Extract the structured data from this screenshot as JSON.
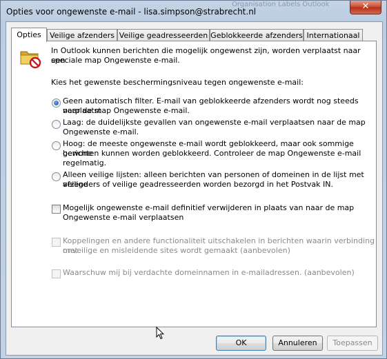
{
  "window": {
    "title": "Opties voor ongewenste e-mail - lisa.simpson@strabrecht.nl",
    "close_glyph": "✕",
    "background_text": "Organisation   Labels   Outlook"
  },
  "tabs": [
    {
      "label": "Opties",
      "active": true
    },
    {
      "label": "Veilige afzenders",
      "active": false
    },
    {
      "label": "Veilige geadresseerden",
      "active": false
    },
    {
      "label": "Geblokkeerde afzenders",
      "active": false
    },
    {
      "label": "Internationaal",
      "active": false
    }
  ],
  "intro": {
    "icon": "junk-mail-folder-icon",
    "line1": "In Outlook kunnen berichten die mogelijk ongewenst zijn, worden verplaatst naar een",
    "line2": "speciale map Ongewenste e-mail."
  },
  "level_prompt": "Kies het gewenste beschermingsniveau tegen ongewenste e-mail:",
  "levels": [
    {
      "selected": true,
      "lines": [
        "Geen automatisch filter. E-mail van geblokkeerde afzenders wordt nog steeds verplaatst",
        "naar de map Ongewenste e-mail."
      ]
    },
    {
      "selected": false,
      "lines": [
        "Laag: de duidelijkste gevallen van ongewenste e-mail verplaatsen naar de map",
        "Ongewenste e-mail."
      ]
    },
    {
      "selected": false,
      "lines": [
        "Hoog: de meeste ongewenste e-mail wordt geblokkeerd, maar ook sommige gewone",
        "berichten kunnen worden geblokkeerd. Controleer de map Ongewenste e-mail",
        "regelmatig."
      ]
    },
    {
      "selected": false,
      "lines": [
        "Alleen veilige lijsten: alleen berichten van personen of domeinen in de lijst met veilige",
        "afzenders of veilige geadresseerden worden bezorgd in het Postvak IN."
      ]
    }
  ],
  "options": [
    {
      "checked": false,
      "disabled": false,
      "lines": [
        "Mogelijk ongewenste e-mail definitief verwijderen in plaats van naar de map",
        "Ongewenste e-mail verplaatsen"
      ]
    },
    {
      "checked": false,
      "disabled": true,
      "lines": [
        "Koppelingen en andere functionaliteit uitschakelen in berichten waarin verbinding met",
        "onveilige en misleidende sites wordt gemaakt (aanbevolen)"
      ]
    },
    {
      "checked": false,
      "disabled": true,
      "lines": [
        "Waarschuw mij bij verdachte domeinnamen in e-mailadressen. (aanbevolen)"
      ]
    }
  ],
  "buttons": {
    "ok": "OK",
    "cancel": "Annuleren",
    "apply": "Toepassen"
  }
}
